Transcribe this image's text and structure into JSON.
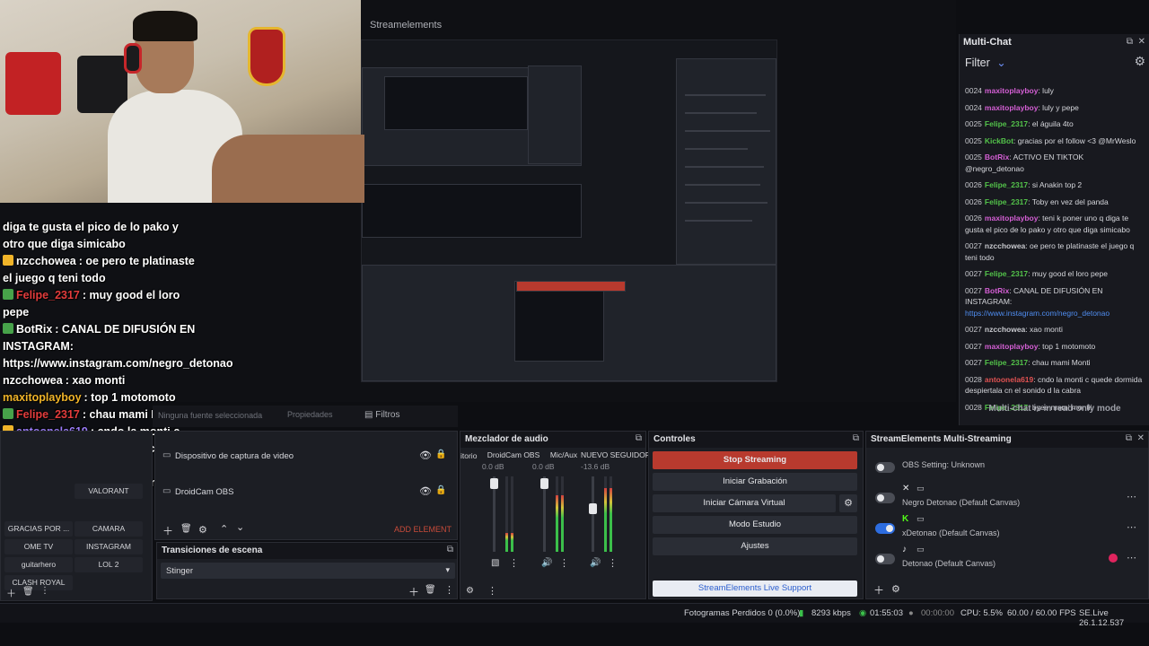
{
  "preview": {
    "title": "Streamelements"
  },
  "webcam_chat": [
    {
      "user": "",
      "text": "diga te gusta el pico de lo pako y otro que diga simicabo",
      "color": "#ffffff",
      "icon": "none"
    },
    {
      "user": "nzcchowea",
      "text": ": oe pero te platinaste el juego q teni todo",
      "color": "#ffffff",
      "icon": "twitch-icon"
    },
    {
      "user": "Felipe_2317",
      "text": ": muy good el loro pepe",
      "color": "#e23c3c",
      "icon": "kick-icon"
    },
    {
      "user": "BotRix",
      "text": ": CANAL DE DIFUSIÓN EN INSTAGRAM: https://www.instagram.com/negro_detonao",
      "color": "#ffffff",
      "icon": "kick-icon"
    },
    {
      "user": "nzcchowea",
      "text": ": xao monti",
      "color": "#ffffff",
      "icon": "none"
    },
    {
      "user": "maxitoplayboy",
      "text": ": top 1 motomoto",
      "color": "#f0b429",
      "icon": "none"
    },
    {
      "user": "Felipe_2317",
      "text": ": chau mami Monti",
      "color": "#e23c3c",
      "icon": "kick-icon"
    },
    {
      "user": "antoonela619",
      "text": ": cndo la monti c quede dormida despiertala cn el sonido d la cabra",
      "color": "#9a7cf7",
      "icon": "twitch-icon"
    },
    {
      "user": "Felipe_2317",
      "text": ": byee mami montii",
      "color": "#e23c3c",
      "icon": "kick-icon"
    }
  ],
  "multichat": {
    "title": "Multi-Chat",
    "filter_label": "Filter",
    "footer": "Multi-chat is in read-only mode",
    "messages": [
      {
        "time": "0024",
        "user": "maxitoplayboy",
        "color": "#d45fd4",
        "text": ": luly"
      },
      {
        "time": "0024",
        "user": "maxitoplayboy",
        "color": "#d45fd4",
        "text": ": luly y pepe"
      },
      {
        "time": "0025",
        "user": "Felipe_2317",
        "color": "#53c24a",
        "text": ": el águila 4to"
      },
      {
        "time": "0025",
        "user": "KickBot",
        "color": "#53c24a",
        "text": ": gracias por el follow <3 @MrWeslo"
      },
      {
        "time": "0025",
        "user": "BotRix",
        "color": "#d45fd4",
        "text": ": ACTIVO EN TIKTOK @negro_detonao"
      },
      {
        "time": "0026",
        "user": "Felipe_2317",
        "color": "#53c24a",
        "text": ": si Anakin top 2"
      },
      {
        "time": "0026",
        "user": "Felipe_2317",
        "color": "#53c24a",
        "text": ": Toby en vez del panda"
      },
      {
        "time": "0026",
        "user": "maxitoplayboy",
        "color": "#d45fd4",
        "text": ": teni k poner uno q diga te gusta el pico de lo pako y otro que diga simicabo"
      },
      {
        "time": "0027",
        "user": "nzcchowea",
        "color": "#c7c8cd",
        "text": ": oe pero te platinaste el juego q teni todo"
      },
      {
        "time": "0027",
        "user": "Felipe_2317",
        "color": "#53c24a",
        "text": ": muy good el loro pepe"
      },
      {
        "time": "0027",
        "user": "BotRix",
        "color": "#d45fd4",
        "text": ": CANAL DE DIFUSIÓN EN INSTAGRAM:",
        "link": "https://www.instagram.com/negro_detonao"
      },
      {
        "time": "0027",
        "user": "nzcchowea",
        "color": "#c7c8cd",
        "text": ": xao monti"
      },
      {
        "time": "0027",
        "user": "maxitoplayboy",
        "color": "#d45fd4",
        "text": ": top 1 motomoto"
      },
      {
        "time": "0027",
        "user": "Felipe_2317",
        "color": "#53c24a",
        "text": ": chau mami Monti"
      },
      {
        "time": "0028",
        "user": "antoonela619",
        "color": "#e05252",
        "text": ": cndo la monti c quede dormida despiertala cn el sonido d la cabra"
      },
      {
        "time": "0028",
        "user": "Felipe_2317",
        "color": "#53c24a",
        "text": ": byee mami montii"
      }
    ]
  },
  "scenes": {
    "visible_buttons": [
      "VALORANT",
      "GRACIAS POR ...",
      "CAMARA",
      "OME TV",
      "INSTAGRAM",
      "guitarhero",
      "LOL 2",
      "CLASH ROYAL"
    ]
  },
  "sources": {
    "tab_properties": "Propiedades",
    "tab_filters": "Filtros",
    "no_source": "Ninguna fuente seleccionada",
    "items": [
      "Dispositivo de captura de video",
      "DroidCam OBS"
    ],
    "add_element": "ADD ELEMENT"
  },
  "transitions": {
    "title": "Transiciones de escena",
    "selected": "Stinger"
  },
  "mixer": {
    "title": "Mezclador de audio",
    "partial_label": "itorio",
    "channels": [
      {
        "name": "DroidCam OBS",
        "db": "0.0 dB",
        "level": 0.25
      },
      {
        "name": "Mic/Aux",
        "db": "0.0 dB",
        "level": 0.75
      },
      {
        "name": "NUEVO SEGUIDOR",
        "db": "-13.6 dB",
        "level": 0.85
      }
    ]
  },
  "controls": {
    "title": "Controles",
    "stop_streaming": "Stop Streaming",
    "recording": "Iniciar Grabación",
    "virtual_cam": "Iniciar Cámara Virtual",
    "studio": "Modo Estudio",
    "settings": "Ajustes",
    "support": "StreamElements Live Support",
    "accent": "#c0392b"
  },
  "multistream": {
    "title": "StreamElements Multi-Streaming",
    "rows": [
      {
        "label": "OBS Setting: Unknown",
        "on": false,
        "platform": ""
      },
      {
        "label": "Negro Detonao (Default Canvas)",
        "on": false,
        "platform": "x-icon"
      },
      {
        "label": "xDetonao (Default Canvas)",
        "on": true,
        "platform": "kick-icon"
      },
      {
        "label": "Detonao (Default Canvas)",
        "on": false,
        "platform": "tiktok-icon"
      }
    ]
  },
  "status": {
    "dropped_frames": "Fotogramas Perdidos 0 (0.0%)",
    "bitrate": "8293 kbps",
    "stream_time": "01:55:03",
    "rec_time": "00:00:00",
    "cpu": "CPU: 5.5%",
    "fps": "60.00 / 60.00 FPS",
    "version": "SE.Live 26.1.12.537"
  }
}
